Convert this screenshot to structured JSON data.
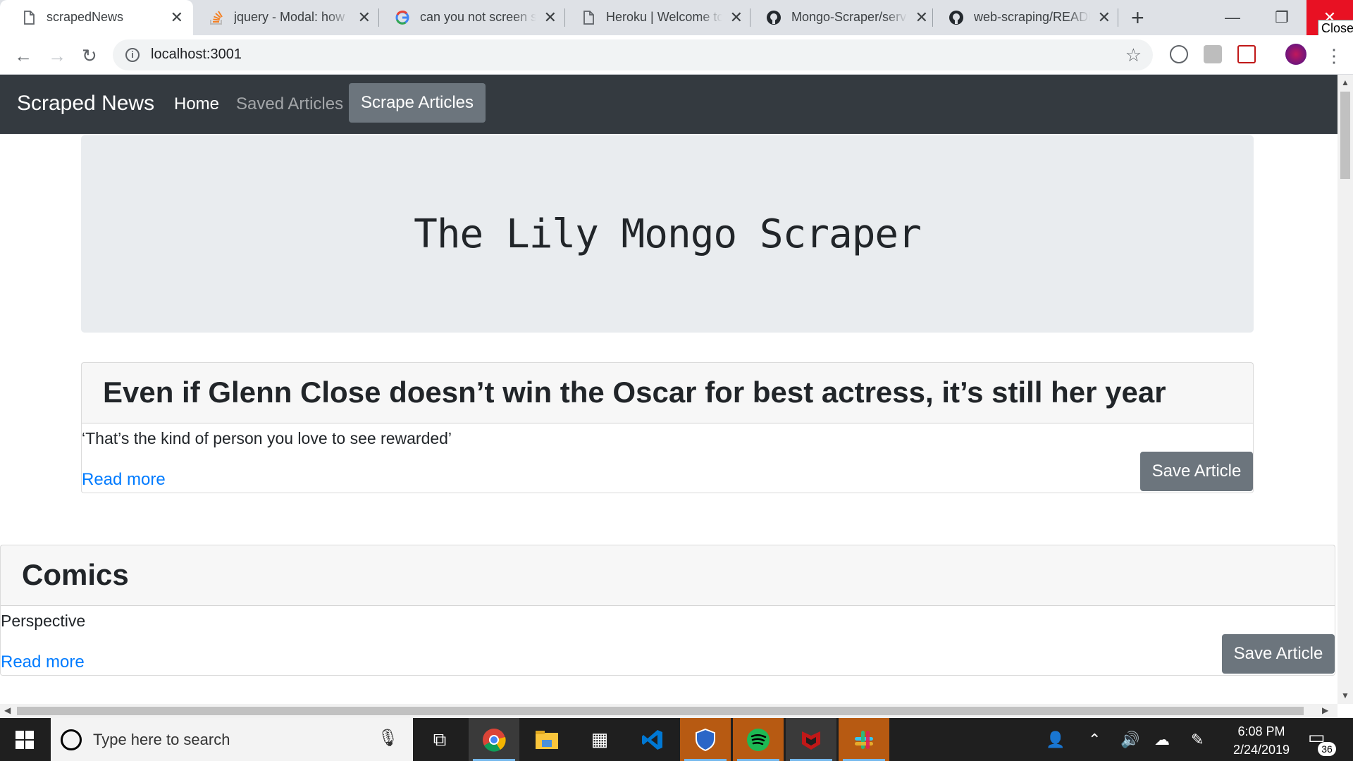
{
  "browser": {
    "tabs": [
      {
        "title": "scrapedNews",
        "active": true,
        "icon": "document-icon"
      },
      {
        "title": "jquery - Modal: how",
        "active": false,
        "icon": "stackoverflow-icon"
      },
      {
        "title": "can you not screen sh",
        "active": false,
        "icon": "google-icon"
      },
      {
        "title": "Heroku | Welcome to",
        "active": false,
        "icon": "document-icon"
      },
      {
        "title": "Mongo-Scraper/serv",
        "active": false,
        "icon": "github-icon"
      },
      {
        "title": "web-scraping/READM",
        "active": false,
        "icon": "github-icon"
      }
    ],
    "close_tooltip": "Close",
    "address": "localhost:3001"
  },
  "navbar": {
    "brand": "Scraped News",
    "links": [
      "Home",
      "Saved Articles"
    ],
    "button": "Scrape Articles"
  },
  "jumbotron": {
    "title": "The Lily Mongo Scraper"
  },
  "articles": [
    {
      "headline": "Even if Glenn Close doesn’t win the Oscar for best actress, it’s still her year",
      "summary": "‘That’s the kind of person you love to see rewarded’",
      "link_text": "Read more",
      "save_label": "Save Article"
    },
    {
      "headline": "Comics",
      "summary": "Perspective",
      "link_text": "Read more",
      "save_label": "Save Article"
    }
  ],
  "taskbar": {
    "search_placeholder": "Type here to search",
    "time": "6:08 PM",
    "date": "2/24/2019",
    "notification_count": "36"
  },
  "colors": {
    "navbar": "#343a40",
    "button": "#6c757d",
    "link": "#007bff",
    "jumbotron": "#e9ecef"
  }
}
